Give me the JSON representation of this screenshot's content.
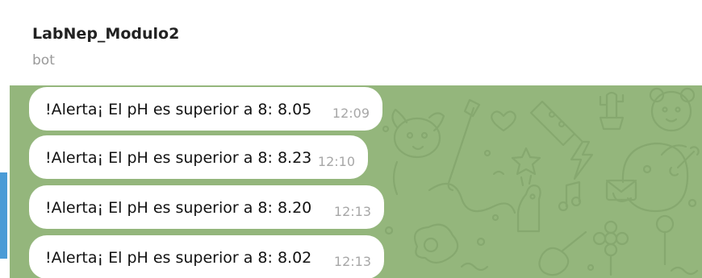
{
  "header": {
    "title": "LabNep_Modulo2",
    "subtitle": "bot"
  },
  "messages": [
    {
      "text": "!Alerta¡ El pH es superior a 8: 8.05",
      "time": "12:09"
    },
    {
      "text": "!Alerta¡ El pH es superior a 8: 8.23",
      "time": "12:10"
    },
    {
      "text": "!Alerta¡ El pH es superior a 8: 8.20",
      "time": "12:13"
    },
    {
      "text": "!Alerta¡ El pH es superior a 8: 8.02",
      "time": "12:13"
    }
  ],
  "colors": {
    "chat_background": "#94b67c",
    "accent": "#4a9bd6",
    "bubble": "#ffffff",
    "time_text": "#a7a7a7"
  },
  "icons": [
    "doodle-wallpaper-pattern"
  ]
}
